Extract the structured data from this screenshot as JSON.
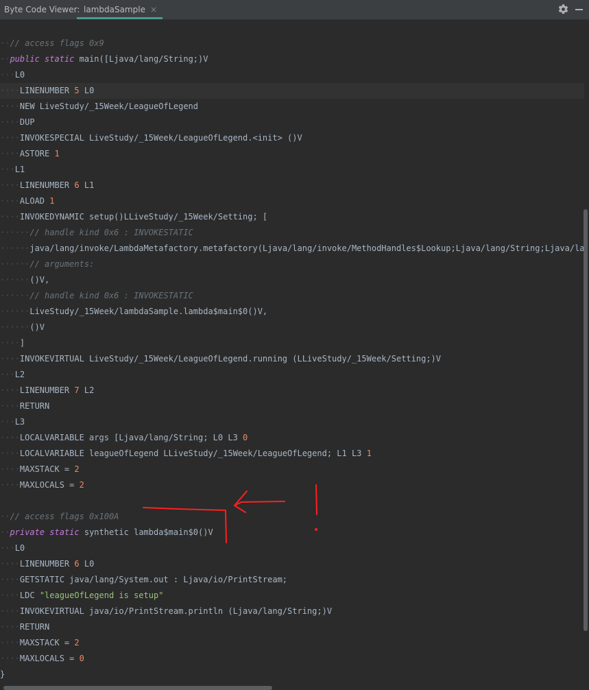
{
  "header": {
    "tool_title": "Byte Code Viewer:",
    "tab_label": "lambdaSample",
    "tab_close_symbol": "×",
    "settings_icon": "gear-icon",
    "minimize_icon": "minimize-icon"
  },
  "colors": {
    "background": "#2b2b2b",
    "header_background": "#3c3f41",
    "tab_underline": "#4a9a91",
    "keyword": "#c679dd",
    "comment": "#6a737a",
    "number": "#eb8b67",
    "string": "#98c379",
    "annotation": "#ff2020"
  },
  "lines": [
    {
      "indent": "··",
      "tokens": [
        {
          "t": "// access flags 0x9",
          "c": "cm"
        }
      ]
    },
    {
      "indent": "··",
      "tokens": [
        {
          "t": "public",
          "c": "kw"
        },
        {
          "t": " "
        },
        {
          "t": "static",
          "c": "kw"
        },
        {
          "t": " main([Ljava/lang/String;)V"
        }
      ]
    },
    {
      "indent": "···",
      "tokens": [
        {
          "t": "L0"
        }
      ]
    },
    {
      "indent": "····",
      "tokens": [
        {
          "t": "LINENUMBER "
        },
        {
          "t": "5",
          "c": "num"
        },
        {
          "t": " L0"
        }
      ],
      "current": true
    },
    {
      "indent": "····",
      "tokens": [
        {
          "t": "NEW LiveStudy/_15Week/LeagueOfLegend"
        }
      ]
    },
    {
      "indent": "····",
      "tokens": [
        {
          "t": "DUP"
        }
      ]
    },
    {
      "indent": "····",
      "tokens": [
        {
          "t": "INVOKESPECIAL LiveStudy/_15Week/LeagueOfLegend.<init> ()V"
        }
      ]
    },
    {
      "indent": "····",
      "tokens": [
        {
          "t": "ASTORE "
        },
        {
          "t": "1",
          "c": "num"
        }
      ]
    },
    {
      "indent": "···",
      "tokens": [
        {
          "t": "L1"
        }
      ]
    },
    {
      "indent": "····",
      "tokens": [
        {
          "t": "LINENUMBER "
        },
        {
          "t": "6",
          "c": "num"
        },
        {
          "t": " L1"
        }
      ]
    },
    {
      "indent": "····",
      "tokens": [
        {
          "t": "ALOAD "
        },
        {
          "t": "1",
          "c": "num"
        }
      ]
    },
    {
      "indent": "····",
      "tokens": [
        {
          "t": "INVOKEDYNAMIC setup()LLiveStudy/_15Week/Setting; ["
        }
      ]
    },
    {
      "indent": "······",
      "tokens": [
        {
          "t": "// handle kind 0x6 : INVOKESTATIC",
          "c": "cm"
        }
      ]
    },
    {
      "indent": "······",
      "tokens": [
        {
          "t": "java/lang/invoke/LambdaMetafactory.metafactory(Ljava/lang/invoke/MethodHandles$Lookup;Ljava/lang/String;Ljava/lang/invoke/MethodType;Ljava/lang/invoke/MethodType;Ljava/lang/invoke/MethodHandle;Ljava/lang/invoke/MethodType;)Ljava/lang/invoke/CallSite;"
        }
      ]
    },
    {
      "indent": "······",
      "tokens": [
        {
          "t": "// arguments:",
          "c": "cm"
        }
      ]
    },
    {
      "indent": "······",
      "tokens": [
        {
          "t": "()V,"
        }
      ]
    },
    {
      "indent": "······",
      "tokens": [
        {
          "t": "// handle kind 0x6 : INVOKESTATIC",
          "c": "cm"
        }
      ]
    },
    {
      "indent": "······",
      "tokens": [
        {
          "t": "LiveStudy/_15Week/lambdaSample.lambda$main$0()V,"
        }
      ]
    },
    {
      "indent": "······",
      "tokens": [
        {
          "t": "()V"
        }
      ]
    },
    {
      "indent": "····",
      "tokens": [
        {
          "t": "]"
        }
      ]
    },
    {
      "indent": "····",
      "tokens": [
        {
          "t": "INVOKEVIRTUAL LiveStudy/_15Week/LeagueOfLegend.running (LLiveStudy/_15Week/Setting;)V"
        }
      ]
    },
    {
      "indent": "···",
      "tokens": [
        {
          "t": "L2"
        }
      ]
    },
    {
      "indent": "····",
      "tokens": [
        {
          "t": "LINENUMBER "
        },
        {
          "t": "7",
          "c": "num"
        },
        {
          "t": " L2"
        }
      ]
    },
    {
      "indent": "····",
      "tokens": [
        {
          "t": "RETURN"
        }
      ]
    },
    {
      "indent": "···",
      "tokens": [
        {
          "t": "L3"
        }
      ]
    },
    {
      "indent": "····",
      "tokens": [
        {
          "t": "LOCALVARIABLE args [Ljava/lang/String; L0 L3 "
        },
        {
          "t": "0",
          "c": "num"
        }
      ]
    },
    {
      "indent": "····",
      "tokens": [
        {
          "t": "LOCALVARIABLE leagueOfLegend LLiveStudy/_15Week/LeagueOfLegend; L1 L3 "
        },
        {
          "t": "1",
          "c": "num"
        }
      ]
    },
    {
      "indent": "····",
      "tokens": [
        {
          "t": "MAXSTACK = "
        },
        {
          "t": "2",
          "c": "num"
        }
      ]
    },
    {
      "indent": "····",
      "tokens": [
        {
          "t": "MAXLOCALS = "
        },
        {
          "t": "2",
          "c": "num"
        }
      ]
    },
    {
      "indent": "",
      "tokens": []
    },
    {
      "indent": "··",
      "tokens": [
        {
          "t": "// access flags 0x100A",
          "c": "cm"
        }
      ]
    },
    {
      "indent": "··",
      "tokens": [
        {
          "t": "private",
          "c": "kw"
        },
        {
          "t": " "
        },
        {
          "t": "static",
          "c": "kw"
        },
        {
          "t": " synthetic lambda$main$0()V"
        }
      ]
    },
    {
      "indent": "···",
      "tokens": [
        {
          "t": "L0"
        }
      ]
    },
    {
      "indent": "····",
      "tokens": [
        {
          "t": "LINENUMBER "
        },
        {
          "t": "6",
          "c": "num"
        },
        {
          "t": " L0"
        }
      ]
    },
    {
      "indent": "····",
      "tokens": [
        {
          "t": "GETSTATIC java/lang/System.out : Ljava/io/PrintStream;"
        }
      ]
    },
    {
      "indent": "····",
      "tokens": [
        {
          "t": "LDC "
        },
        {
          "t": "\"leagueOfLegend is setup\"",
          "c": "str"
        }
      ]
    },
    {
      "indent": "····",
      "tokens": [
        {
          "t": "INVOKEVIRTUAL java/io/PrintStream.println (Ljava/lang/String;)V"
        }
      ]
    },
    {
      "indent": "····",
      "tokens": [
        {
          "t": "RETURN"
        }
      ]
    },
    {
      "indent": "····",
      "tokens": [
        {
          "t": "MAXSTACK = "
        },
        {
          "t": "2",
          "c": "num"
        }
      ]
    },
    {
      "indent": "····",
      "tokens": [
        {
          "t": "MAXLOCALS = "
        },
        {
          "t": "0",
          "c": "num"
        }
      ]
    },
    {
      "indent": "",
      "tokens": [
        {
          "t": "}"
        }
      ]
    }
  ]
}
